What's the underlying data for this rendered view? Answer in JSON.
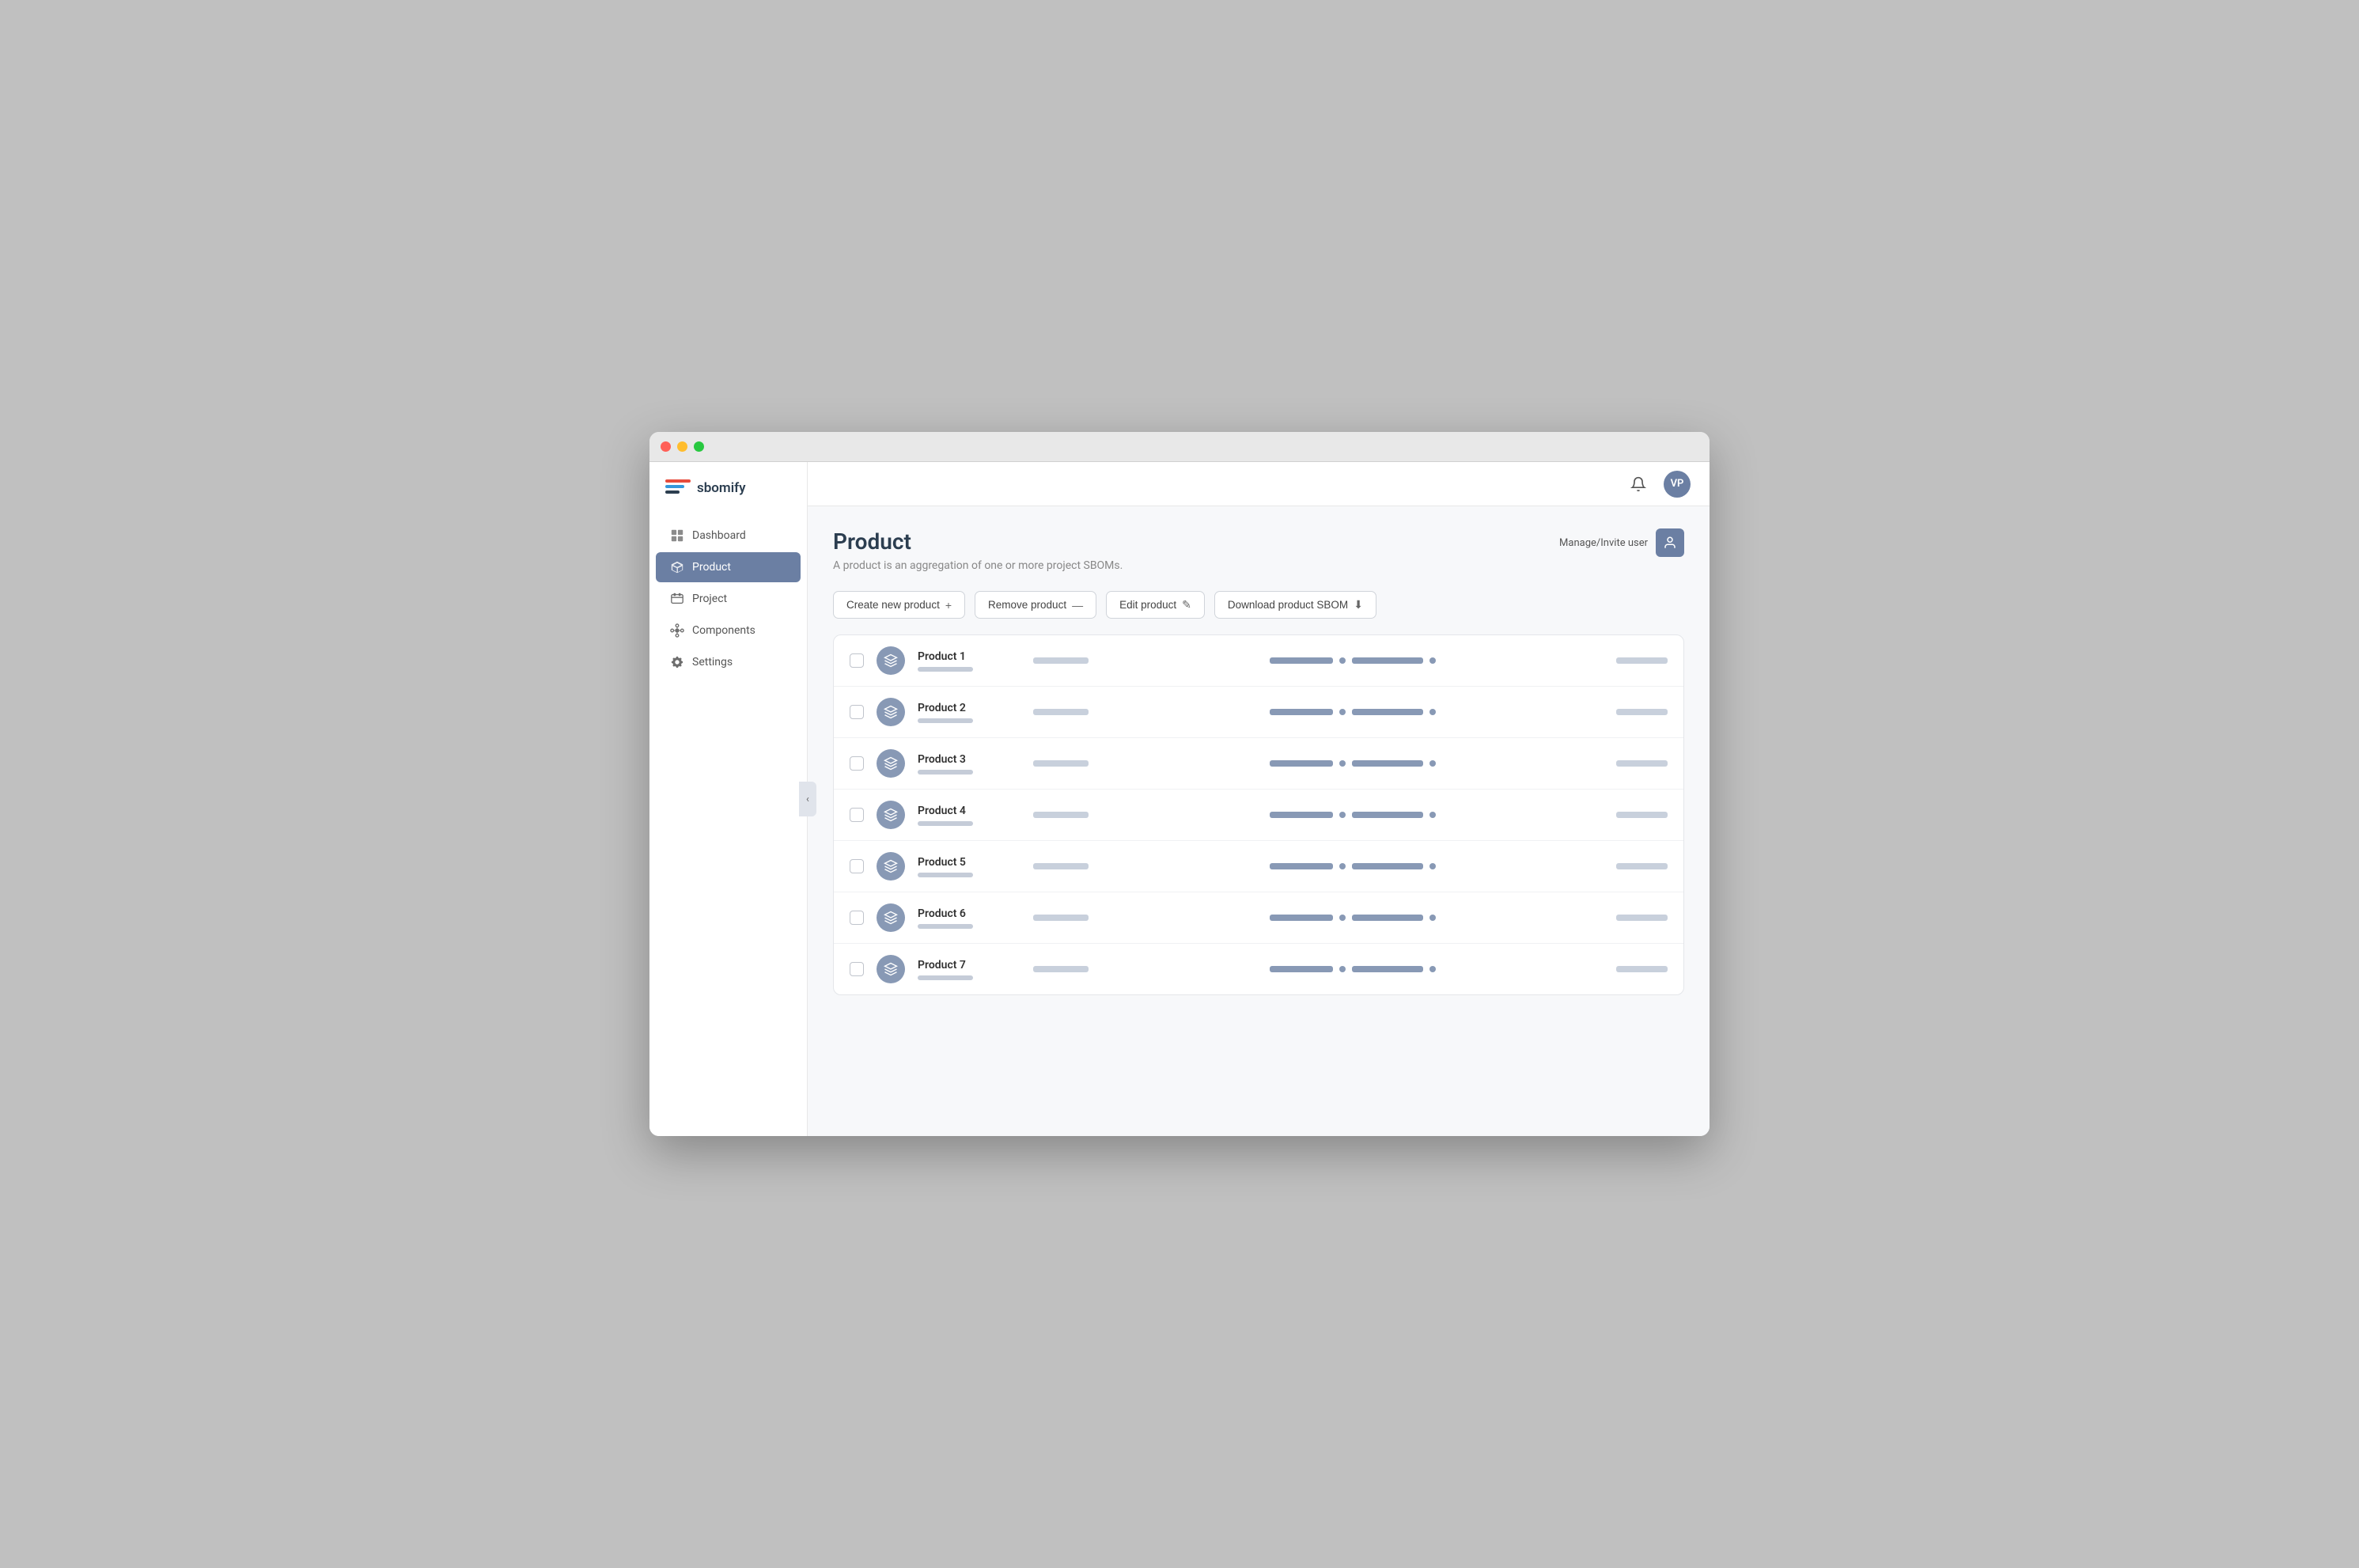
{
  "window": {
    "title": "sbomify"
  },
  "logo": {
    "text": "sbomify"
  },
  "sidebar": {
    "items": [
      {
        "id": "dashboard",
        "label": "Dashboard",
        "active": false
      },
      {
        "id": "product",
        "label": "Product",
        "active": true
      },
      {
        "id": "project",
        "label": "Project",
        "active": false
      },
      {
        "id": "components",
        "label": "Components",
        "active": false
      },
      {
        "id": "settings",
        "label": "Settings",
        "active": false
      }
    ]
  },
  "topbar": {
    "avatar_initials": "VP"
  },
  "page": {
    "title": "Product",
    "subtitle": "A product is an aggregation of one or more project SBOMs.",
    "manage_user_label": "Manage/Invite user"
  },
  "toolbar": {
    "buttons": [
      {
        "id": "create",
        "label": "Create new product",
        "icon": "+"
      },
      {
        "id": "remove",
        "label": "Remove product",
        "icon": "—"
      },
      {
        "id": "edit",
        "label": "Edit product",
        "icon": "✎"
      },
      {
        "id": "download",
        "label": "Download product SBOM",
        "icon": "⬇"
      }
    ]
  },
  "products": [
    {
      "id": 1,
      "name": "Product 1"
    },
    {
      "id": 2,
      "name": "Product 2"
    },
    {
      "id": 3,
      "name": "Product 3"
    },
    {
      "id": 4,
      "name": "Product 4"
    },
    {
      "id": 5,
      "name": "Product 5"
    },
    {
      "id": 6,
      "name": "Product 6"
    },
    {
      "id": 7,
      "name": "Product 7"
    }
  ],
  "sidebar_toggle_icon": "‹"
}
